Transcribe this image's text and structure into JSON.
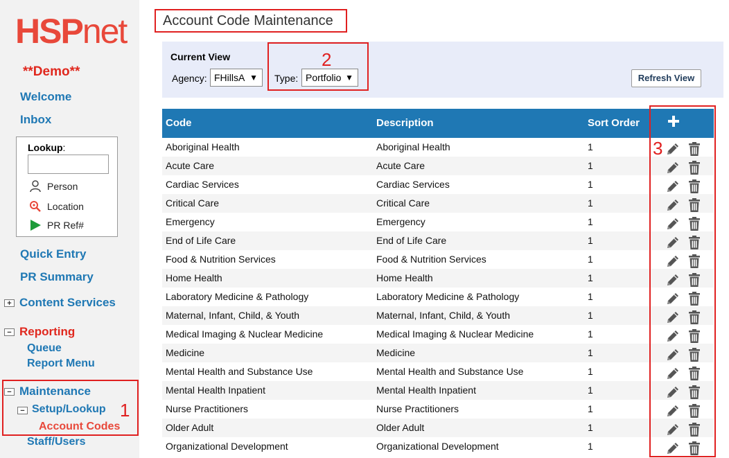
{
  "sidebar": {
    "logo_hsp": "HSP",
    "logo_net": "net",
    "demo": "**Demo**",
    "welcome": "Welcome",
    "inbox": "Inbox",
    "lookup_label": "Lookup",
    "lookup_colon": ":",
    "lookup_person": "Person",
    "lookup_location": "Location",
    "lookup_prref": "PR Ref#",
    "quick_entry": "Quick Entry",
    "pr_summary": "PR Summary",
    "content_services": "Content Services",
    "reporting": "Reporting",
    "queue": "Queue",
    "report_menu": "Report Menu",
    "maintenance": "Maintenance",
    "setup_lookup": "Setup/Lookup",
    "account_codes": "Account Codes",
    "staff_users": "Staff/Users",
    "expand_plus": "+",
    "collapse_minus": "−"
  },
  "annotations": [
    "1",
    "2",
    "3"
  ],
  "page": {
    "title": "Account Code Maintenance"
  },
  "current_view": {
    "heading": "Current View",
    "agency_label": "Agency:",
    "agency_value": "FHillsA",
    "type_label": "Type:",
    "type_value": "Portfolio",
    "arrow": "▼",
    "refresh_label": "Refresh View"
  },
  "table": {
    "headers": {
      "code": "Code",
      "description": "Description",
      "sort_order": "Sort Order"
    },
    "rows": [
      {
        "code": "Aboriginal Health",
        "description": "Aboriginal Health",
        "sort": "1"
      },
      {
        "code": "Acute Care",
        "description": "Acute Care",
        "sort": "1"
      },
      {
        "code": "Cardiac Services",
        "description": "Cardiac Services",
        "sort": "1"
      },
      {
        "code": "Critical Care",
        "description": "Critical Care",
        "sort": "1"
      },
      {
        "code": "Emergency",
        "description": "Emergency",
        "sort": "1"
      },
      {
        "code": "End of Life Care",
        "description": "End of Life Care",
        "sort": "1"
      },
      {
        "code": "Food & Nutrition Services",
        "description": "Food & Nutrition Services",
        "sort": "1"
      },
      {
        "code": "Home Health",
        "description": "Home Health",
        "sort": "1"
      },
      {
        "code": "Laboratory Medicine & Pathology",
        "description": "Laboratory Medicine & Pathology",
        "sort": "1"
      },
      {
        "code": "Maternal, Infant, Child, & Youth",
        "description": "Maternal, Infant, Child, & Youth",
        "sort": "1"
      },
      {
        "code": "Medical Imaging & Nuclear Medicine",
        "description": "Medical Imaging & Nuclear Medicine",
        "sort": "1"
      },
      {
        "code": "Medicine",
        "description": "Medicine",
        "sort": "1"
      },
      {
        "code": "Mental Health and Substance Use",
        "description": "Mental Health and Substance Use",
        "sort": "1"
      },
      {
        "code": "Mental Health Inpatient",
        "description": "Mental Health Inpatient",
        "sort": "1"
      },
      {
        "code": "Nurse Practitioners",
        "description": "Nurse Practitioners",
        "sort": "1"
      },
      {
        "code": "Older Adult",
        "description": "Older Adult",
        "sort": "1"
      },
      {
        "code": "Organizational Development",
        "description": "Organizational Development",
        "sort": "1"
      }
    ]
  },
  "colors": {
    "brand": "#e8483a",
    "link": "#1f78b4",
    "header": "#1f78b4",
    "annotation": "#e02020"
  }
}
